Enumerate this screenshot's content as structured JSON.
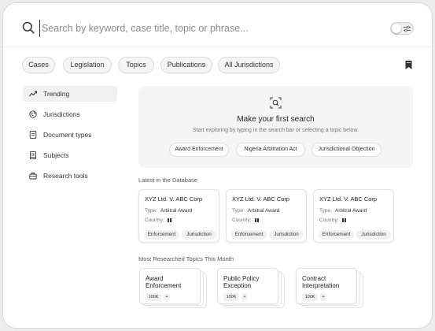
{
  "search": {
    "placeholder": "Search by keyword, case title, topic or phrase...",
    "value": ""
  },
  "filters": [
    "Cases",
    "Legislation",
    "Topics",
    "Publications",
    "All Jurisdictions"
  ],
  "sidebar": {
    "items": [
      {
        "label": "Trending",
        "icon": "trending-icon",
        "active": true
      },
      {
        "label": "Jurisdictions",
        "icon": "globe-icon",
        "active": false
      },
      {
        "label": "Document types",
        "icon": "document-icon",
        "active": false
      },
      {
        "label": "Subjects",
        "icon": "book-icon",
        "active": false
      },
      {
        "label": "Research tools",
        "icon": "toolbox-icon",
        "active": false
      }
    ]
  },
  "empty_state": {
    "title": "Make your first search",
    "subtitle": "Start exploring by typing in the search bar or selecting a topic below.",
    "suggestions": [
      "Award Enforcement",
      "Nigeria Arbitration Act",
      "Jurisdictional Objection"
    ]
  },
  "latest": {
    "heading": "Latest in the Database",
    "type_label": "Type:",
    "country_label": "Country:",
    "cards": [
      {
        "title": "XYZ Ltd. V. ABC Corp",
        "type": "Arbitral Award",
        "tags": [
          "Enforcement",
          "Jurisdiction"
        ]
      },
      {
        "title": "XYZ Ltd. V. ABC Corp",
        "type": "Arbitral Award",
        "tags": [
          "Enforcement",
          "Jurisdiction"
        ]
      },
      {
        "title": "XYZ Ltd. V. ABC Corp",
        "type": "Arbitral Award",
        "tags": [
          "Enforcement",
          "Jurisdiction"
        ]
      }
    ]
  },
  "topics": {
    "heading": "Most Researched Topics This Month",
    "cards": [
      {
        "title": "Award Enforcement",
        "count": "100K",
        "more": "+"
      },
      {
        "title": "Public Policy Exception",
        "count": "100K",
        "more": "+"
      },
      {
        "title": "Contract Interpretation",
        "count": "100K",
        "more": "+"
      }
    ]
  },
  "colors": {
    "background": "#ececec",
    "panel": "#ffffff",
    "card_muted": "#f5f5f5",
    "text": "#1f1f1f"
  }
}
